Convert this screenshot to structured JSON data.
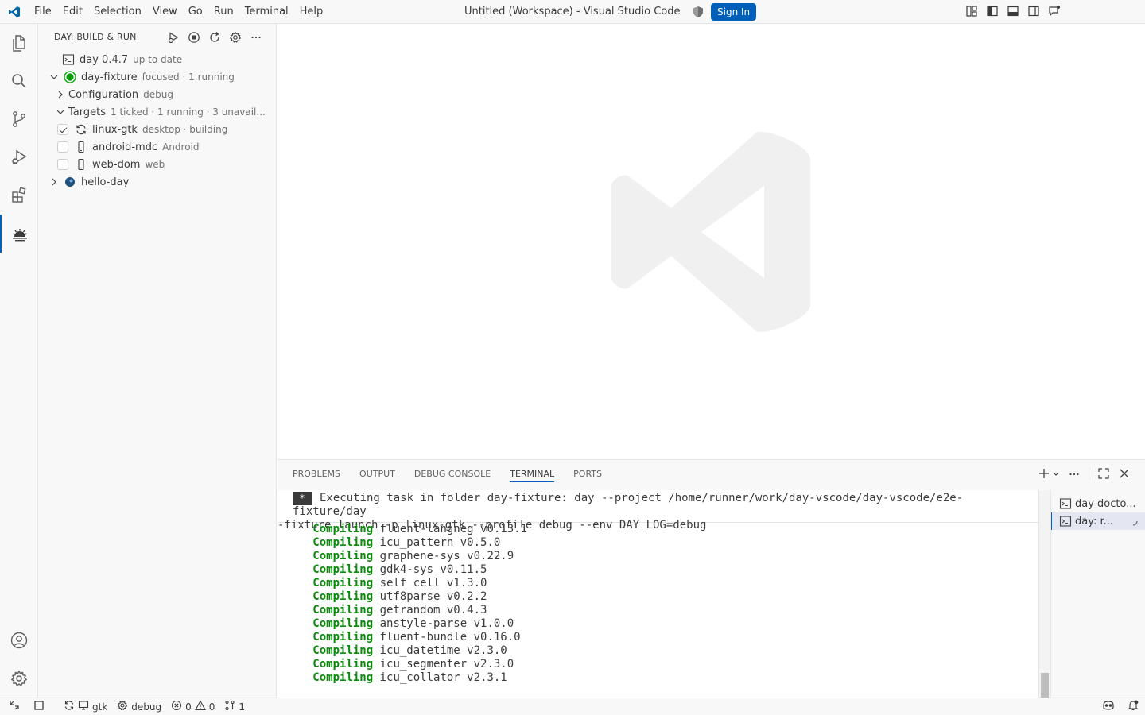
{
  "titlebar": {
    "menu": [
      "File",
      "Edit",
      "Selection",
      "View",
      "Go",
      "Run",
      "Terminal",
      "Help"
    ],
    "window_title": "Untitled (Workspace) - Visual Studio Code",
    "signin_label": "Sign In"
  },
  "sidebar": {
    "header": "DAY: BUILD & RUN",
    "tree": [
      {
        "label": "day 0.4.7",
        "desc": "up to date"
      },
      {
        "label": "day-fixture",
        "desc": "focused · 1 running"
      },
      {
        "label": "Configuration",
        "desc": "debug"
      },
      {
        "label": "Targets",
        "desc": "1 ticked · 1 running · 3 unavail..."
      },
      {
        "label": "linux-gtk",
        "desc": "desktop · building",
        "checked": true
      },
      {
        "label": "android-mdc",
        "desc": "Android",
        "checked": false
      },
      {
        "label": "web-dom",
        "desc": "web",
        "checked": false
      },
      {
        "label": "hello-day",
        "desc": ""
      }
    ]
  },
  "panel": {
    "tabs": [
      "PROBLEMS",
      "OUTPUT",
      "DEBUG CONSOLE",
      "TERMINAL",
      "PORTS"
    ],
    "active_tab": "TERMINAL",
    "task_line1": "Executing task in folder day-fixture: day --project /home/runner/work/day-vscode/day-vscode/e2e-fixture/day",
    "task_line2": "-fixture launch -p linux-gtk --profile debug --env DAY_LOG=debug",
    "task_star": "*",
    "compile_keyword": "Compiling",
    "crates": [
      "fluent-langneg v0.13.1",
      "icu_pattern v0.5.0",
      "graphene-sys v0.22.9",
      "gdk4-sys v0.11.5",
      "self_cell v1.3.0",
      "utf8parse v0.2.2",
      "getrandom v0.4.3",
      "anstyle-parse v1.0.0",
      "fluent-bundle v0.16.0",
      "icu_datetime v2.3.0",
      "icu_segmenter v2.3.0",
      "icu_collator v2.3.1"
    ],
    "terminals": [
      "day docto...",
      "day: r..."
    ]
  },
  "statusbar": {
    "platform": "gtk",
    "profile": "debug",
    "errors": "0",
    "warnings": "0",
    "targets": "1"
  },
  "colors": {
    "accent": "#005fb8",
    "running": "#00a000",
    "compile_green": "#0a8a0a"
  }
}
